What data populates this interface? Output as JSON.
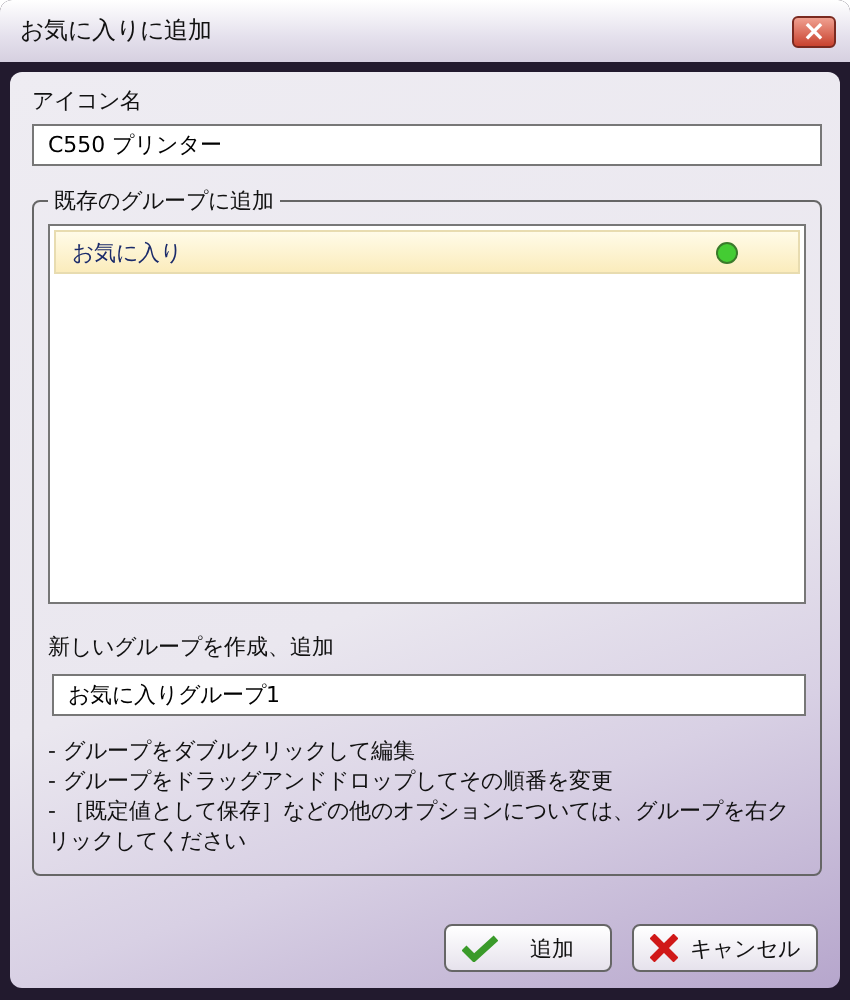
{
  "window": {
    "title": "お気に入りに追加",
    "close": "×"
  },
  "icon_name": {
    "label": "アイコン名",
    "value": "C550 プリンター"
  },
  "existing_groups": {
    "legend": "既存のグループに追加",
    "groups": [
      {
        "name": "お気に入り",
        "selected": true,
        "color": "#44cc33"
      }
    ],
    "new_group": {
      "label": "新しいグループを作成、追加",
      "value": "お気に入りグループ1"
    },
    "hints": [
      "- グループをダブルクリックして編集",
      "- グループをドラッグアンドドロップしてその順番を変更",
      "- ［既定値として保存］などの他のオプションについては、グループを右クリックしてください"
    ]
  },
  "buttons": [
    {
      "kind": "ok",
      "label": "追加"
    },
    {
      "kind": "cancel",
      "label": "キャンセル"
    }
  ]
}
